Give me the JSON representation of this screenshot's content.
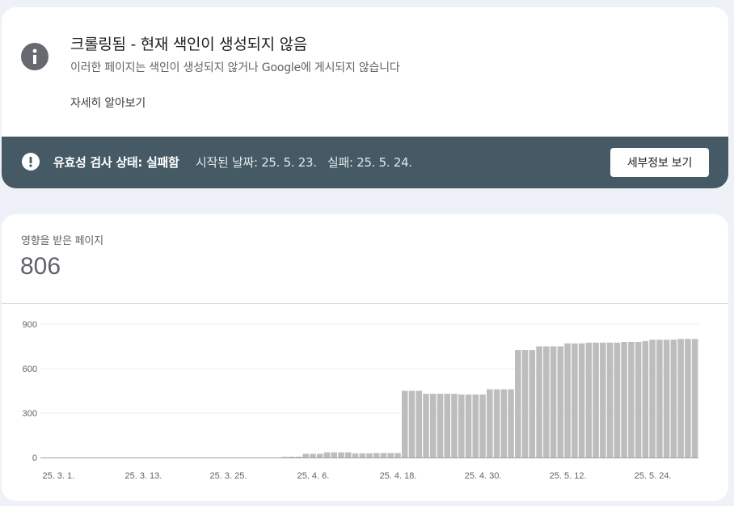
{
  "header": {
    "icon": "info-icon",
    "title": "크롤링됨 - 현재 색인이 생성되지 않음",
    "subtitle": "이러한 페이지는 색인이 생성되지 않거나 Google에 게시되지 않습니다",
    "learn_more": "자세히 알아보기"
  },
  "status_bar": {
    "icon": "alert-icon",
    "label": "유효성 검사 상태: 실패함",
    "started": "시작된 날짜: 25. 5. 23.",
    "failed": "실패: 25. 5. 24.",
    "details_button": "세부정보 보기",
    "background_color": "#455a64"
  },
  "metric": {
    "label": "영향을 받은 페이지",
    "value": "806"
  },
  "chart_data": {
    "type": "bar",
    "bar_color": "#bdbdbd",
    "ylim": [
      0,
      900
    ],
    "yticks": [
      0,
      300,
      600,
      900
    ],
    "xtick_labels": [
      "25. 3. 1.",
      "25. 3. 13.",
      "25. 3. 25.",
      "25. 4. 6.",
      "25. 4. 18.",
      "25. 4. 30.",
      "25. 5. 12.",
      "25. 5. 24."
    ],
    "xtick_indices": [
      0,
      12,
      24,
      36,
      48,
      60,
      72,
      84
    ],
    "values": [
      0,
      0,
      0,
      0,
      0,
      0,
      0,
      0,
      0,
      0,
      0,
      0,
      0,
      0,
      0,
      0,
      0,
      0,
      0,
      0,
      0,
      0,
      0,
      0,
      0,
      0,
      0,
      0,
      0,
      0,
      0,
      0,
      0,
      0,
      3,
      5,
      5,
      25,
      25,
      25,
      35,
      35,
      35,
      35,
      28,
      28,
      28,
      30,
      30,
      30,
      30,
      450,
      450,
      450,
      430,
      430,
      430,
      430,
      430,
      425,
      425,
      425,
      425,
      460,
      460,
      460,
      460,
      725,
      725,
      725,
      750,
      750,
      750,
      750,
      770,
      770,
      770,
      775,
      775,
      775,
      775,
      775,
      780,
      780,
      780,
      785,
      795,
      795,
      795,
      795,
      800,
      800,
      800
    ]
  }
}
